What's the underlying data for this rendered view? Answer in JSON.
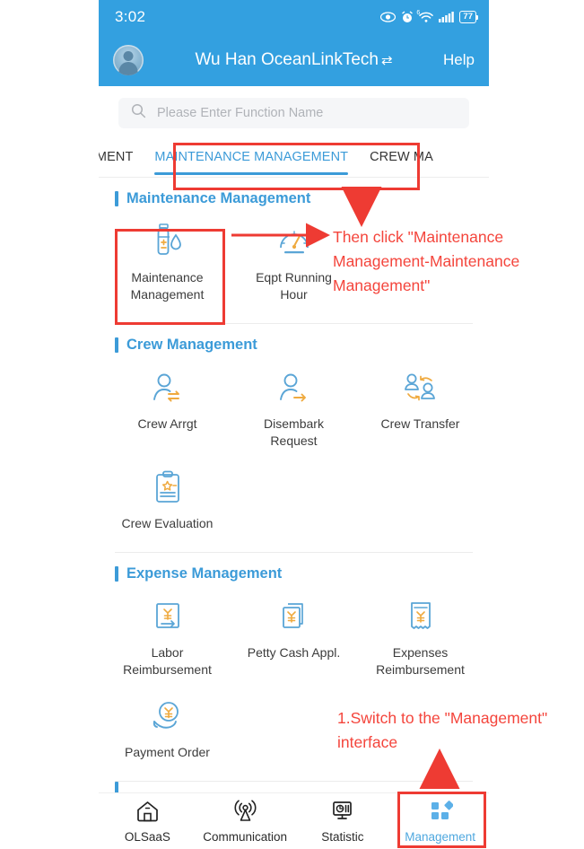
{
  "status_bar": {
    "time": "3:02",
    "battery_percent": "77",
    "icons": [
      "eye-icon",
      "alarm-clock-icon",
      "wifi-icon",
      "signal-bars-icon",
      "battery-icon"
    ],
    "wifi_label": "6"
  },
  "app_bar": {
    "title": "Wu Han OceanLinkTech",
    "switch_icon": "⇄",
    "help_label": "Help",
    "avatar": "user-avatar"
  },
  "search": {
    "placeholder": "Please Enter Function Name",
    "value": ""
  },
  "tabs": [
    {
      "label": "AGEMENT",
      "active": false
    },
    {
      "label": "MAINTENANCE MANAGEMENT",
      "active": true
    },
    {
      "label": "CREW MA",
      "active": false
    }
  ],
  "sections": [
    {
      "title": "Maintenance Management",
      "items": [
        {
          "label": "Maintenance\nManagement",
          "icon": "oil-bottle-icon"
        },
        {
          "label": "Eqpt Running\nHour",
          "icon": "gauge-icon"
        }
      ]
    },
    {
      "title": "Crew Management",
      "items": [
        {
          "label": "Crew Arrgt",
          "icon": "person-exchange-icon"
        },
        {
          "label": "Disembark\nRequest",
          "icon": "person-arrow-icon"
        },
        {
          "label": "Crew Transfer",
          "icon": "two-person-transfer-icon"
        },
        {
          "label": "Crew Evaluation",
          "icon": "clipboard-star-icon"
        }
      ]
    },
    {
      "title": "Expense Management",
      "items": [
        {
          "label": "Labor\nReimbursement",
          "icon": "yen-arrow-box-icon"
        },
        {
          "label": "Petty Cash Appl.",
          "icon": "yen-documents-icon"
        },
        {
          "label": "Expenses\nReimbursement",
          "icon": "yen-receipt-icon"
        },
        {
          "label": "Payment Order",
          "icon": "yen-hand-icon"
        }
      ]
    }
  ],
  "bottom_nav": [
    {
      "label": "OLSaaS",
      "icon": "home-icon",
      "active": false
    },
    {
      "label": "Communication",
      "icon": "broadcast-icon",
      "active": false
    },
    {
      "label": "Statistic",
      "icon": "monitor-chart-icon",
      "active": false
    },
    {
      "label": "Management",
      "icon": "grid-squares-icon",
      "active": true
    }
  ],
  "annotations": [
    {
      "text": "Then click \"Maintenance Management-Maintenance Management\"",
      "color": "#F4453C"
    },
    {
      "text": "1.Switch to the \"Management\" interface",
      "color": "#F4453C"
    }
  ],
  "colors": {
    "header_blue": "#33A0E0",
    "accent_blue": "#3C9BD8",
    "icon_blue": "#4E9FD4",
    "icon_orange": "#EFAA3F",
    "annotation_red": "#F4453C",
    "highlight_box_red": "#EE3B33"
  }
}
